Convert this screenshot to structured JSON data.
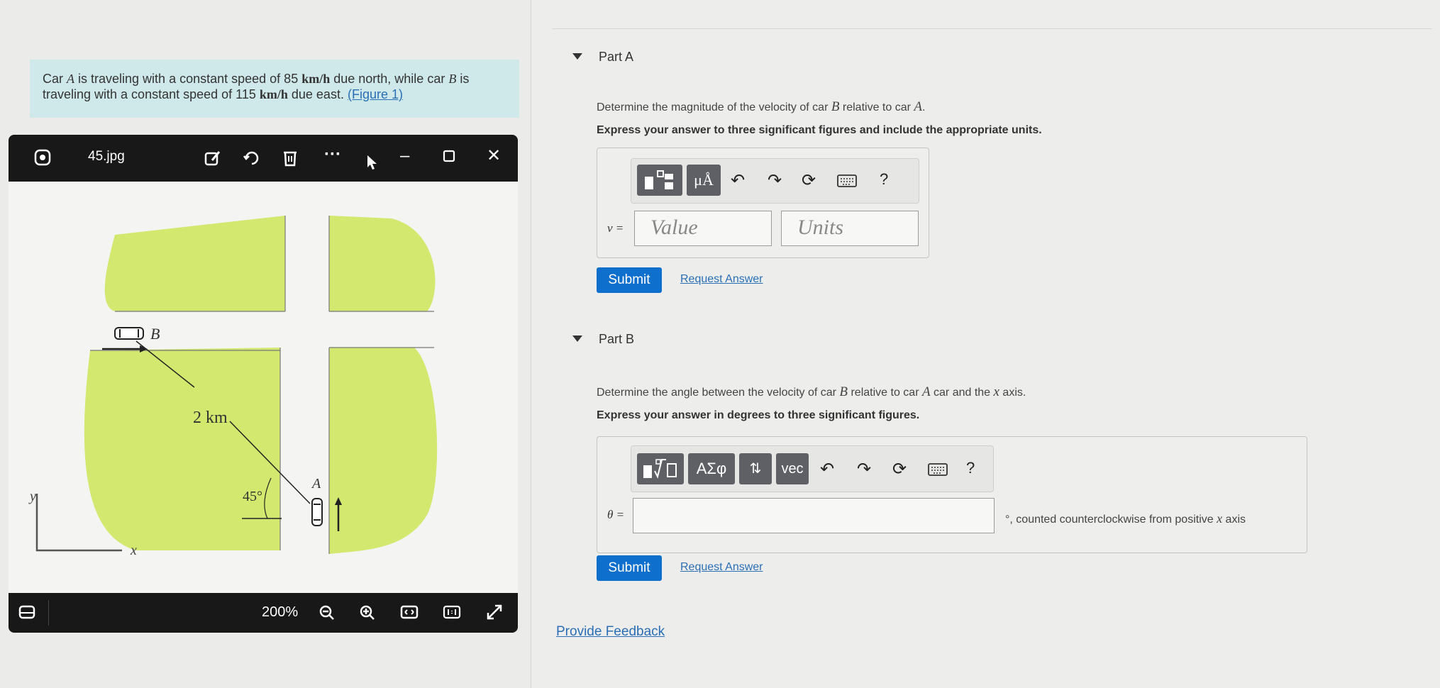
{
  "problem": {
    "text_1": "Car ",
    "car_a": "A",
    "text_2": " is traveling with a constant speed of 85 ",
    "unit_1": "km/h",
    "text_3": " due north, while car ",
    "car_b": "B",
    "text_4": " is traveling with a constant speed of 115 ",
    "unit_2": "km/h",
    "text_5": " due east. ",
    "figure_link": "(Figure 1)"
  },
  "viewer": {
    "file_name": "45.jpg",
    "zoom": "200%",
    "figure": {
      "label_b": "B",
      "label_a": "A",
      "distance": "2 km",
      "angle": "45°",
      "axis_y": "y",
      "axis_x": "x"
    }
  },
  "part_a": {
    "title": "Part A",
    "prompt_1": "Determine the magnitude of the velocity of car ",
    "prompt_b": "B",
    "prompt_2": " relative to car ",
    "prompt_a": "A",
    "prompt_3": ".",
    "instruction": "Express your answer to three significant figures and include the appropriate units.",
    "var_label": "v =",
    "value_placeholder": "Value",
    "units_placeholder": "Units",
    "submit": "Submit",
    "request": "Request Answer",
    "toolbar": {
      "units_btn": "μÅ",
      "help": "?"
    }
  },
  "part_b": {
    "title": "Part B",
    "prompt_1": "Determine the angle between the velocity of car ",
    "prompt_b": "B",
    "prompt_2": " relative to car ",
    "prompt_a": "A",
    "prompt_3": " car and the ",
    "prompt_x": "x",
    "prompt_4": " axis.",
    "instruction": "Express your answer in degrees to three significant figures.",
    "var_label": "θ =",
    "suffix_1": "°, counted counterclockwise from positive ",
    "suffix_x": "x",
    "suffix_2": " axis",
    "submit": "Submit",
    "request": "Request Answer",
    "toolbar": {
      "greek_btn": "ΑΣφ",
      "vec_btn": "vec",
      "help": "?"
    }
  },
  "feedback": "Provide Feedback",
  "colors": {
    "accent": "#0f6fcc",
    "link": "#2a6fb5",
    "grass": "#d2e86e",
    "problem_bg": "#cfe9ea"
  }
}
